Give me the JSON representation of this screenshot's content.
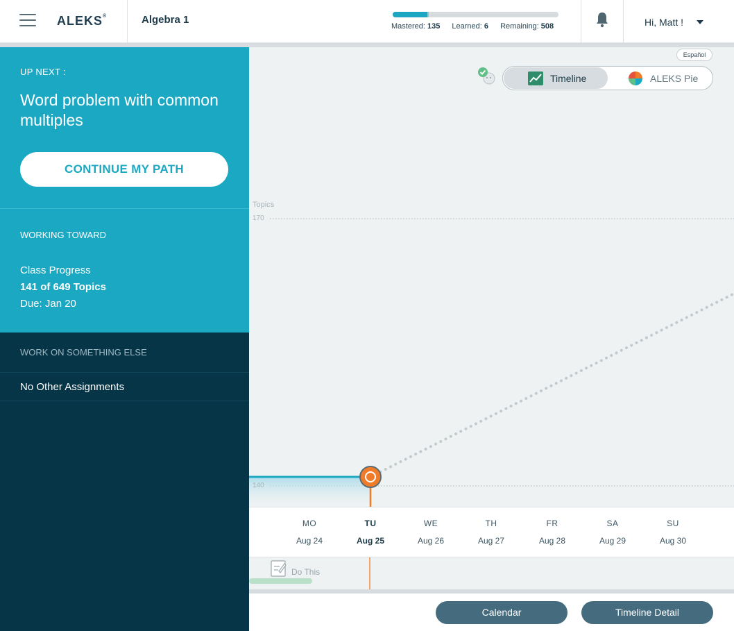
{
  "header": {
    "logo": "ALEKS",
    "logo_mark": "®",
    "course": "Algebra 1",
    "progress": {
      "mastered": 135,
      "learned": 6,
      "remaining": 508,
      "total": 649
    },
    "stats": {
      "mastered_label": "Mastered:",
      "mastered_value": "135",
      "learned_label": "Learned:",
      "learned_value": "6",
      "remaining_label": "Remaining:",
      "remaining_value": "508"
    },
    "greeting": "Hi, Matt !"
  },
  "sidebar": {
    "up_next_label": "UP NEXT :",
    "up_next_title": "Word problem with common multiples",
    "continue_label": "CONTINUE MY PATH",
    "working_label": "WORKING TOWARD",
    "class_progress": "Class Progress",
    "topics_count": "141 of 649 Topics",
    "due": "Due: Jan 20",
    "work_else_label": "WORK ON SOMETHING ELSE",
    "no_other": "No Other Assignments"
  },
  "main": {
    "espanol": "Español",
    "toggle": {
      "timeline": "Timeline",
      "pie": "ALEKS Pie",
      "active": "timeline"
    },
    "y_axis_title": "Topics",
    "y_ticks": [
      "170",
      "140"
    ],
    "assignment": "Do This",
    "days": [
      {
        "name": "MO",
        "date": "Aug 24"
      },
      {
        "name": "TU",
        "date": "Aug 25",
        "current": true
      },
      {
        "name": "WE",
        "date": "Aug 26"
      },
      {
        "name": "TH",
        "date": "Aug 27"
      },
      {
        "name": "FR",
        "date": "Aug 28"
      },
      {
        "name": "SA",
        "date": "Aug 29"
      },
      {
        "name": "SU",
        "date": "Aug 30"
      }
    ],
    "buttons": {
      "calendar": "Calendar",
      "timeline_detail": "Timeline Detail"
    }
  },
  "colors": {
    "teal": "#1ba8c3",
    "navy": "#063547",
    "orange": "#f07c2a",
    "slate_button": "#456c7e"
  }
}
